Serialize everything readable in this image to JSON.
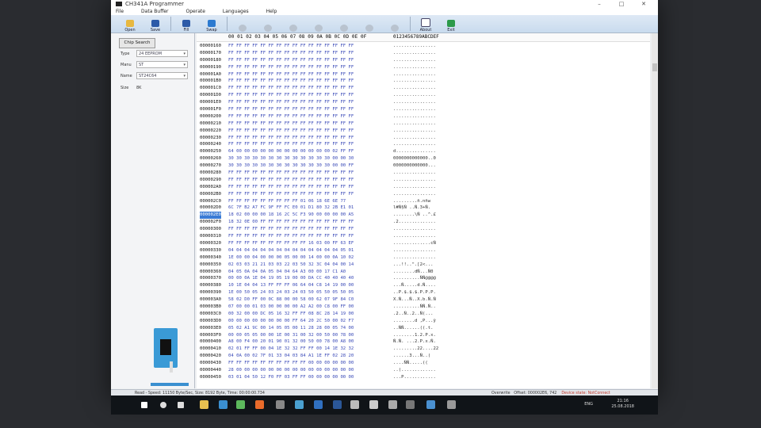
{
  "window": {
    "title": "CH341A Programmer",
    "controls": [
      "–",
      "□",
      "✕"
    ]
  },
  "menu": [
    "File",
    "Data Buffer",
    "Operate",
    "Languages",
    "Help"
  ],
  "toolbar": [
    {
      "label": "Open",
      "icon": "folder-icon",
      "enabled": true,
      "color": "#e8b840"
    },
    {
      "label": "Save",
      "icon": "save-icon",
      "enabled": true,
      "color": "#2c5aa8"
    },
    {
      "label": "Fill",
      "icon": "fill-icon",
      "enabled": true,
      "color": "#2c5aa8"
    },
    {
      "label": "Swap",
      "icon": "swap-icon",
      "enabled": true,
      "color": "#2c7ad0"
    },
    {
      "label": "",
      "icon": "detect-icon",
      "enabled": false
    },
    {
      "label": "",
      "icon": "erase-icon",
      "enabled": false
    },
    {
      "label": "",
      "icon": "read-icon",
      "enabled": false
    },
    {
      "label": "",
      "icon": "program-icon",
      "enabled": false
    },
    {
      "label": "",
      "icon": "verify-icon",
      "enabled": false
    },
    {
      "label": "",
      "icon": "auto-icon",
      "enabled": false
    },
    {
      "label": "",
      "icon": "stop-icon",
      "enabled": false
    },
    {
      "label": "About",
      "icon": "info-icon",
      "enabled": true,
      "color": "#ffffff"
    },
    {
      "label": "Exit",
      "icon": "exit-icon",
      "enabled": true,
      "color": "#2c9a4a"
    }
  ],
  "left": {
    "chip_search": "Chip Search",
    "type_label": "Type",
    "type_value": "24 EEPROM",
    "manu_label": "Manu",
    "manu_value": "ST",
    "name_label": "Name",
    "name_value": "ST24C64",
    "size_label": "Size",
    "size_value": "8K"
  },
  "hex": {
    "header": "00 01 02 03 04 05 06 07 08 09 0A 0B 0C 0D 0E 0F",
    "ascii_header": "0123456789ABCDEF",
    "rows": [
      {
        "a": "00000160",
        "h": "FF FF FF FF FF FF FF FF FF FF FF FF FF FF FF FF",
        "s": "................"
      },
      {
        "a": "00000170",
        "h": "FF FF FF FF FF FF FF FF FF FF FF FF FF FF FF FF",
        "s": "................"
      },
      {
        "a": "00000180",
        "h": "FF FF FF FF FF FF FF FF FF FF FF FF FF FF FF FF",
        "s": "................"
      },
      {
        "a": "00000190",
        "h": "FF FF FF FF FF FF FF FF FF FF FF FF FF FF FF FF",
        "s": "................"
      },
      {
        "a": "000001A0",
        "h": "FF FF FF FF FF FF FF FF FF FF FF FF FF FF FF FF",
        "s": "................"
      },
      {
        "a": "000001B0",
        "h": "FF FF FF FF FF FF FF FF FF FF FF FF FF FF FF FF",
        "s": "................"
      },
      {
        "a": "000001C0",
        "h": "FF FF FF FF FF FF FF FF FF FF FF FF FF FF FF FF",
        "s": "................"
      },
      {
        "a": "000001D0",
        "h": "FF FF FF FF FF FF FF FF FF FF FF FF FF FF FF FF",
        "s": "................"
      },
      {
        "a": "000001E0",
        "h": "FF FF FF FF FF FF FF FF FF FF FF FF FF FF FF FF",
        "s": "................"
      },
      {
        "a": "000001F0",
        "h": "FF FF FF FF FF FF FF FF FF FF FF FF FF FF FF FF",
        "s": "................"
      },
      {
        "a": "00000200",
        "h": "FF FF FF FF FF FF FF FF FF FF FF FF FF FF FF FF",
        "s": "................"
      },
      {
        "a": "00000210",
        "h": "FF FF FF FF FF FF FF FF FF FF FF FF FF FF FF FF",
        "s": "................"
      },
      {
        "a": "00000220",
        "h": "FF FF FF FF FF FF FF FF FF FF FF FF FF FF FF FF",
        "s": "................"
      },
      {
        "a": "00000230",
        "h": "FF FF FF FF FF FF FF FF FF FF FF FF FF FF FF FF",
        "s": "................"
      },
      {
        "a": "00000240",
        "h": "FF FF FF FF FF FF FF FF FF FF FF FF FF FF FF FF",
        "s": "................"
      },
      {
        "a": "00000250",
        "h": "64 00 00 00 00 00 00 00 00 00 00 00 00 02 FF FF",
        "s": "d..............."
      },
      {
        "a": "00000260",
        "h": "30 30 30 30 30 30 30 30 30 30 30 30 30 00 00 30",
        "s": "0000000000000..0"
      },
      {
        "a": "00000270",
        "h": "30 30 30 30 30 30 30 30 30 30 30 30 30 00 00 FF",
        "s": "0000000000000..."
      },
      {
        "a": "00000280",
        "h": "FF FF FF FF FF FF FF FF FF FF FF FF FF FF FF FF",
        "s": "................"
      },
      {
        "a": "00000290",
        "h": "FF FF FF FF FF FF FF FF FF FF FF FF FF FF FF FF",
        "s": "................"
      },
      {
        "a": "000002A0",
        "h": "FF FF FF FF FF FF FF FF FF FF FF FF FF FF FF FF",
        "s": "................"
      },
      {
        "a": "000002B0",
        "h": "FF FF FF FF FF FF FF FF FF FF FF FF FF FF FF FF",
        "s": "................"
      },
      {
        "a": "000002C0",
        "h": "FF FF FF FF FF FF FF FF FF 01 06 18 6E 6E 77",
        "s": ".........ñ.nñw"
      },
      {
        "a": "000002D0",
        "h": "6C 7F B2 A7 FC 9F FF FC E0 01 D1 80 32 2B E1 01",
        "s": "l#Ñ§Ñ ..Ñ.3+Ñ."
      },
      {
        "a": "000002E0",
        "h": "18 02 00 00 00 18 16 2C 5C F3 90 00 00 00 00 A5",
        "s": "........\\Ñ ..^.£"
      },
      {
        "a": "000002F0",
        "h": "18 32 0E 00 FF FF FF FF FF FF FF FF FF FF FF FF",
        "s": ".2.............."
      },
      {
        "a": "00000300",
        "h": "FF FF FF FF FF FF FF FF FF FF FF FF FF FF FF FF",
        "s": "................"
      },
      {
        "a": "00000310",
        "h": "FF FF FF FF FF FF FF FF FF FF FF FF FF FF FF FF",
        "s": "................"
      },
      {
        "a": "00000320",
        "h": "FF FF FF FF FF FF FF FF FF FF 16 03 00 FF 63 EF",
        "s": "..............cÑ"
      },
      {
        "a": "00000330",
        "h": "04 04 04 04 04 04 04 04 04 04 04 04 04 04 05 01",
        "s": "................"
      },
      {
        "a": "00000340",
        "h": "1E 00 00 04 00 00 00 05 00 00 14 00 00 0A 10 02",
        "s": "................"
      },
      {
        "a": "00000350",
        "h": "02 03 03 21 21 03 03 22 03 50 32 3C 04 04 00 14",
        "s": "...!!..\".[2<..."
      },
      {
        "a": "00000360",
        "h": "04 05 0A 04 0A 05 04 04 64 A3 00 00 17 C1 A0",
        "s": "........dÑ...Ñ0"
      },
      {
        "a": "00000370",
        "h": "00 00 0A 1E 04 19 05 19 00 00 DA CC 40 40 40 40",
        "s": "..........ÑÑ@@@@"
      },
      {
        "a": "00000380",
        "h": "10 1E 04 04 13 FF FF FF 06 64 04 C8 14 19 00 00",
        "s": "...Ñ.....d.Ñ...."
      },
      {
        "a": "00000390",
        "h": "1E 00 50 05 24 03 24 03 24 03 50 05 50 05 50 05",
        "s": "..P.$.$.$.P.P.P."
      },
      {
        "a": "000003A0",
        "h": "58 02 D0 FF 00 0C 88 00 00 58 00 62 07 9F 84 C0",
        "s": "X.Ñ...Ñ..X.b.Ñ.Ñ"
      },
      {
        "a": "000003B0",
        "h": "07 00 00 01 03 00 00 00 00 A2 A2 00 C8 00 FF 00",
        "s": "..........ÑÑ.Ñ.."
      },
      {
        "a": "000003C0",
        "h": "00 32 00 00 DC 05 16 32 FF FF 08 8C 28 14 19 00",
        "s": ".2..Ñ..2..Ñ(..."
      },
      {
        "a": "000003D0",
        "h": "00 00 00 00 00 00 00 00 FF 64 20 2C 50 00 02 F7",
        "s": "........d ,P...ÿ"
      },
      {
        "a": "000003E0",
        "h": "05 02 A1 9C 00 14 05 05 00 11 28 28 00 05 74 00",
        "s": "..ÑÑ......((.t."
      },
      {
        "a": "000003F0",
        "h": "00 00 05 05 00 00 1E 00 31 00 32 00 50 00 78 00",
        "s": "........1.2.P.x."
      },
      {
        "a": "00000400",
        "h": "A8 00 F4 00 20 01 90 01 32 00 50 00 78 00 A8 00",
        "s": "Ñ.Ñ. ...2.P.x.Ñ."
      },
      {
        "a": "00000410",
        "h": "02 01 FF FF 00 04 1E 32 32 FF FF 00 14 1E 32 32",
        "s": ".........22....22"
      },
      {
        "a": "00000420",
        "h": "04 0A 00 02 7F 01 33 04 03 84 A1 1E FF 02 28 20",
        "s": "......3...Ñ..( "
      },
      {
        "a": "00000430",
        "h": "FF FF FF FF FF FF FF FF FF FF 00 00 00 00 00 00",
        "s": "....ÑÑ.....(("
      },
      {
        "a": "00000440",
        "h": "28 00 00 00 00 00 00 00 00 00 00 00 00 00 00 00",
        "s": "..(............."
      },
      {
        "a": "00000450",
        "h": "03 01 04 50 12 F0 FF 03 FF FF 00 00 00 00 00 00",
        "s": "...P............"
      }
    ],
    "highlight_index": 24
  },
  "status": {
    "left": "Read - Speed: 11150 Byte/Sec, Size: 8192 Byte, Time: 00:00:00.734",
    "mode": "Overwrite",
    "offset": "Offset: 000002E6, 742",
    "device": "Device state: NotConnect"
  },
  "taskbar": {
    "lang": "ENG",
    "time": "21:16",
    "date": "25.08.2018",
    "icons": [
      {
        "name": "start-icon",
        "color": "#ffffff"
      },
      {
        "name": "search-icon",
        "color": "#dddddd"
      },
      {
        "name": "task-view-icon",
        "color": "#dddddd"
      },
      {
        "name": "explorer-icon",
        "color": "#e8c050"
      },
      {
        "name": "store-icon",
        "color": "#3a8fd0"
      },
      {
        "name": "chrome-icon",
        "color": "#5cb85c"
      },
      {
        "name": "firefox-icon",
        "color": "#e86a2a"
      },
      {
        "name": "calculator-icon",
        "color": "#888888"
      },
      {
        "name": "app-icon",
        "color": "#4aa0d0"
      },
      {
        "name": "app-icon-2",
        "color": "#3070c0"
      },
      {
        "name": "word-icon",
        "color": "#2b5797"
      },
      {
        "name": "photos-icon",
        "color": "#bbbbbb"
      },
      {
        "name": "app-icon-3",
        "color": "#cccccc"
      },
      {
        "name": "app-icon-4",
        "color": "#aaaaaa"
      },
      {
        "name": "app-icon-5",
        "color": "#777777"
      },
      {
        "name": "app-icon-6",
        "color": "#4a90d0"
      },
      {
        "name": "programmer-icon",
        "color": "#999999"
      }
    ]
  }
}
